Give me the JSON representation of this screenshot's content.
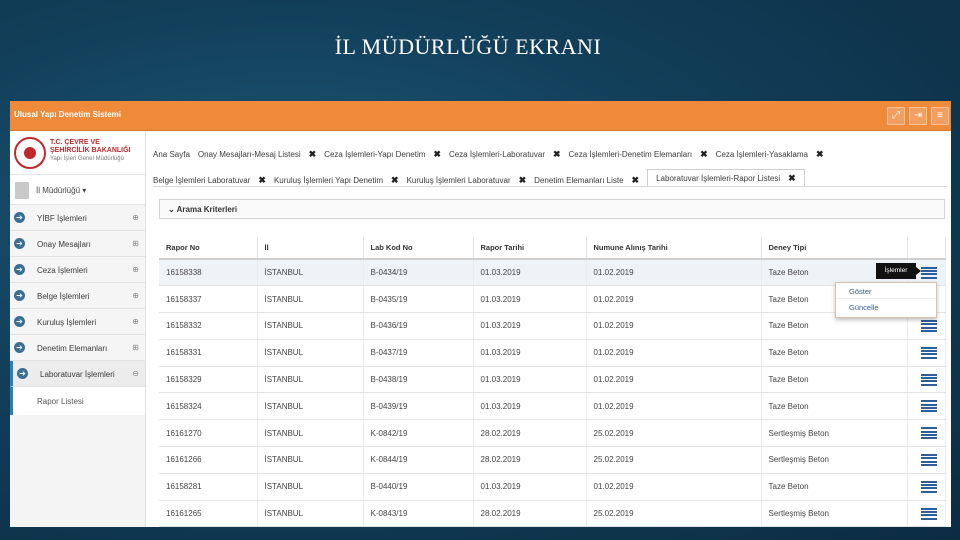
{
  "slide_title": "İL MÜDÜRLÜĞÜ EKRANI",
  "app": {
    "name": "Ulusal Yapı Denetim Sistemi",
    "logo_line1": "T.C. ÇEVRE VE",
    "logo_line2": "ŞEHİRCİLİK BAKANLIĞI",
    "logo_line3": "Yapı İşleri Genel Müdürlüğü"
  },
  "user": {
    "label": "İl Müdürlüğü ▾"
  },
  "sidebar": {
    "items": [
      {
        "label": "YİBF İşlemleri",
        "exp": "⊕"
      },
      {
        "label": "Onay Mesajları",
        "exp": "⊞"
      },
      {
        "label": "Ceza İşlemleri",
        "exp": "⊕"
      },
      {
        "label": "Belge İşlemleri",
        "exp": "⊕"
      },
      {
        "label": "Kuruluş İşlemleri",
        "exp": "⊕"
      },
      {
        "label": "Denetim Elemanları",
        "exp": "⊞"
      },
      {
        "label": "Laboratuvar İşlemleri",
        "exp": "⊖"
      }
    ],
    "sub_item": "Rapor Listesi"
  },
  "tabs": {
    "row1": [
      {
        "label": "Ana Sayfa",
        "x": ""
      },
      {
        "label": "Onay Mesajları-Mesaj Listesi",
        "x": "✖"
      },
      {
        "label": "Ceza İşlemleri-Yapı Denetim",
        "x": "✖"
      },
      {
        "label": "Ceza İşlemleri-Laboratuvar",
        "x": "✖"
      },
      {
        "label": "Ceza İşlemleri-Denetim Elemanları",
        "x": "✖"
      },
      {
        "label": "Ceza İşlemleri-Yasaklama",
        "x": "✖"
      }
    ],
    "row2": [
      {
        "label": "Belge İşlemleri Laboratuvar",
        "x": "✖"
      },
      {
        "label": "Kuruluş İşlemleri Yapı Denetim",
        "x": "✖"
      },
      {
        "label": "Kuruluş İşlemleri Laboratuvar",
        "x": "✖"
      },
      {
        "label": "Denetim Elemanları Liste",
        "x": "✖"
      },
      {
        "label": "Laboratuvar İşlemleri-Rapor Listesi",
        "x": "✖"
      }
    ]
  },
  "filter": {
    "label": "⌄ Arama Kriterleri"
  },
  "table": {
    "headers": [
      "Rapor No",
      "İl",
      "Lab Kod No",
      "Rapor Tarihi",
      "Numune Alınış Tarihi",
      "Deney Tipi"
    ],
    "rows": [
      [
        "16158338",
        "İSTANBUL",
        "B-0434/19",
        "01.03.2019",
        "01.02.2019",
        "Taze Beton"
      ],
      [
        "16158337",
        "İSTANBUL",
        "B-0435/19",
        "01.03.2019",
        "01.02.2019",
        "Taze Beton"
      ],
      [
        "16158332",
        "İSTANBUL",
        "B-0436/19",
        "01.03.2019",
        "01.02.2019",
        "Taze Beton"
      ],
      [
        "16158331",
        "İSTANBUL",
        "B-0437/19",
        "01.03.2019",
        "01.02.2019",
        "Taze Beton"
      ],
      [
        "16158329",
        "İSTANBUL",
        "B-0438/19",
        "01.03.2019",
        "01.02.2019",
        "Taze Beton"
      ],
      [
        "16158324",
        "İSTANBUL",
        "B-0439/19",
        "01.03.2019",
        "01.02.2019",
        "Taze Beton"
      ],
      [
        "16161270",
        "İSTANBUL",
        "K-0842/19",
        "28.02.2019",
        "25.02.2019",
        "Sertleşmiş Beton"
      ],
      [
        "16161266",
        "İSTANBUL",
        "K-0844/19",
        "28.02.2019",
        "25.02.2019",
        "Sertleşmiş Beton"
      ],
      [
        "16158281",
        "İSTANBUL",
        "B-0440/19",
        "01.03.2019",
        "01.02.2019",
        "Taze Beton"
      ],
      [
        "16161265",
        "İSTANBUL",
        "K-0843/19",
        "28.02.2019",
        "25.02.2019",
        "Sertleşmiş Beton"
      ]
    ]
  },
  "popup": {
    "label": "İşlemler",
    "options": [
      "Göster",
      "Güncelle"
    ]
  },
  "icons": [
    "expand-icon",
    "logout-icon",
    "menu-icon"
  ]
}
